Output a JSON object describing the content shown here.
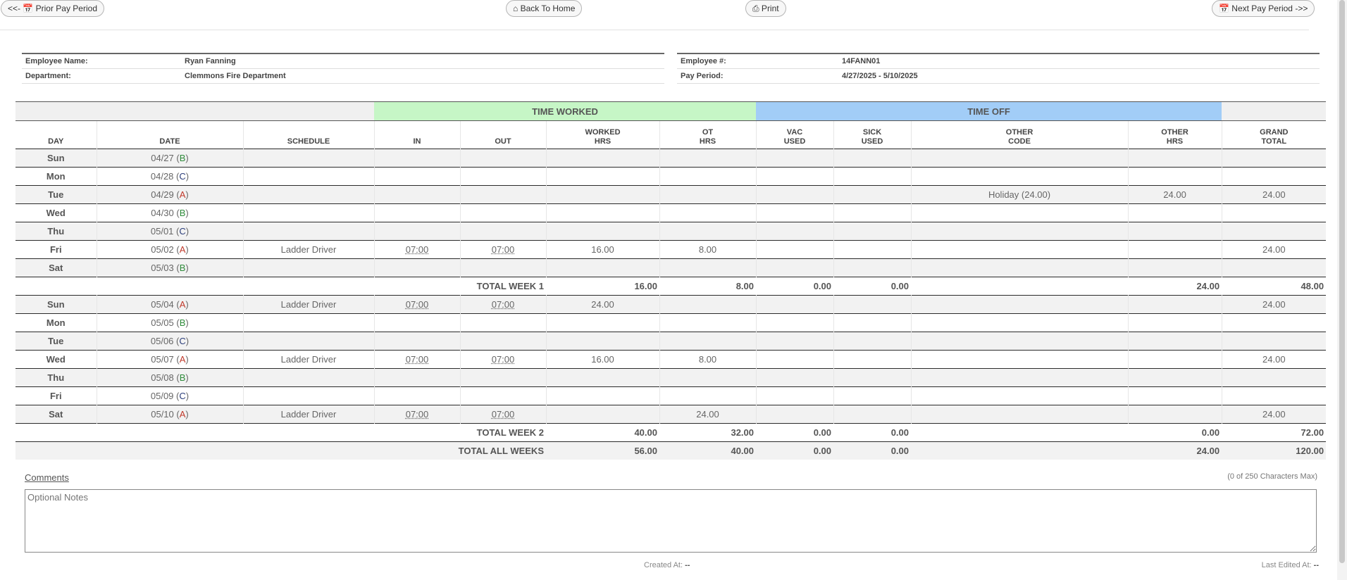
{
  "toolbar": {
    "prior": "<<- 📅 Prior Pay Period",
    "home": "⌂ Back To Home",
    "print": "⎙ Print",
    "next": "📅 Next Pay Period ->>"
  },
  "employee": {
    "name_label": "Employee Name:",
    "name": "Ryan Fanning",
    "dept_label": "Department:",
    "dept": "Clemmons Fire Department",
    "num_label": "Employee #:",
    "num": "14FANN01",
    "period_label": "Pay Period:",
    "period": "4/27/2025 - 5/10/2025"
  },
  "groups": {
    "time_worked": "TIME WORKED",
    "time_off": "TIME OFF"
  },
  "columns": {
    "day": "DAY",
    "date": "DATE",
    "schedule": "SCHEDULE",
    "in": "IN",
    "out": "OUT",
    "worked_1": "WORKED",
    "worked_2": "HRS",
    "ot_1": "OT",
    "ot_2": "HRS",
    "vac_1": "VAC",
    "vac_2": "USED",
    "sick_1": "SICK",
    "sick_2": "USED",
    "oc_1": "OTHER",
    "oc_2": "CODE",
    "oh_1": "OTHER",
    "oh_2": "HRS",
    "gt_1": "GRAND",
    "gt_2": "TOTAL"
  },
  "week1": [
    {
      "day": "Sun",
      "date": "04/27",
      "code": "B",
      "schedule": "",
      "in": "",
      "out": "",
      "worked": "",
      "ot": "",
      "vac": "",
      "sick": "",
      "other_code": "",
      "other_hrs": "",
      "total": ""
    },
    {
      "day": "Mon",
      "date": "04/28",
      "code": "C",
      "schedule": "",
      "in": "",
      "out": "",
      "worked": "",
      "ot": "",
      "vac": "",
      "sick": "",
      "other_code": "",
      "other_hrs": "",
      "total": ""
    },
    {
      "day": "Tue",
      "date": "04/29",
      "code": "A",
      "schedule": "",
      "in": "",
      "out": "",
      "worked": "",
      "ot": "",
      "vac": "",
      "sick": "",
      "other_code": "Holiday (24.00)",
      "other_hrs": "24.00",
      "total": "24.00"
    },
    {
      "day": "Wed",
      "date": "04/30",
      "code": "B",
      "schedule": "",
      "in": "",
      "out": "",
      "worked": "",
      "ot": "",
      "vac": "",
      "sick": "",
      "other_code": "",
      "other_hrs": "",
      "total": ""
    },
    {
      "day": "Thu",
      "date": "05/01",
      "code": "C",
      "schedule": "",
      "in": "",
      "out": "",
      "worked": "",
      "ot": "",
      "vac": "",
      "sick": "",
      "other_code": "",
      "other_hrs": "",
      "total": ""
    },
    {
      "day": "Fri",
      "date": "05/02",
      "code": "A",
      "schedule": "Ladder Driver",
      "in": "07:00",
      "out": "07:00",
      "worked": "16.00",
      "ot": "8.00",
      "vac": "",
      "sick": "",
      "other_code": "",
      "other_hrs": "",
      "total": "24.00"
    },
    {
      "day": "Sat",
      "date": "05/03",
      "code": "B",
      "schedule": "",
      "in": "",
      "out": "",
      "worked": "",
      "ot": "",
      "vac": "",
      "sick": "",
      "other_code": "",
      "other_hrs": "",
      "total": ""
    }
  ],
  "total_week1": {
    "label": "TOTAL WEEK 1",
    "worked": "16.00",
    "ot": "8.00",
    "vac": "0.00",
    "sick": "0.00",
    "other_hrs": "24.00",
    "total": "48.00"
  },
  "week2": [
    {
      "day": "Sun",
      "date": "05/04",
      "code": "A",
      "schedule": "Ladder Driver",
      "in": "07:00",
      "out": "07:00",
      "worked": "24.00",
      "ot": "",
      "vac": "",
      "sick": "",
      "other_code": "",
      "other_hrs": "",
      "total": "24.00"
    },
    {
      "day": "Mon",
      "date": "05/05",
      "code": "B",
      "schedule": "",
      "in": "",
      "out": "",
      "worked": "",
      "ot": "",
      "vac": "",
      "sick": "",
      "other_code": "",
      "other_hrs": "",
      "total": ""
    },
    {
      "day": "Tue",
      "date": "05/06",
      "code": "C",
      "schedule": "",
      "in": "",
      "out": "",
      "worked": "",
      "ot": "",
      "vac": "",
      "sick": "",
      "other_code": "",
      "other_hrs": "",
      "total": ""
    },
    {
      "day": "Wed",
      "date": "05/07",
      "code": "A",
      "schedule": "Ladder Driver",
      "in": "07:00",
      "out": "07:00",
      "worked": "16.00",
      "ot": "8.00",
      "vac": "",
      "sick": "",
      "other_code": "",
      "other_hrs": "",
      "total": "24.00"
    },
    {
      "day": "Thu",
      "date": "05/08",
      "code": "B",
      "schedule": "",
      "in": "",
      "out": "",
      "worked": "",
      "ot": "",
      "vac": "",
      "sick": "",
      "other_code": "",
      "other_hrs": "",
      "total": ""
    },
    {
      "day": "Fri",
      "date": "05/09",
      "code": "C",
      "schedule": "",
      "in": "",
      "out": "",
      "worked": "",
      "ot": "",
      "vac": "",
      "sick": "",
      "other_code": "",
      "other_hrs": "",
      "total": ""
    },
    {
      "day": "Sat",
      "date": "05/10",
      "code": "A",
      "schedule": "Ladder Driver",
      "in": "07:00",
      "out": "07:00",
      "worked": "",
      "ot": "24.00",
      "vac": "",
      "sick": "",
      "other_code": "",
      "other_hrs": "",
      "total": "24.00"
    }
  ],
  "total_week2": {
    "label": "TOTAL WEEK 2",
    "worked": "40.00",
    "ot": "32.00",
    "vac": "0.00",
    "sick": "0.00",
    "other_hrs": "0.00",
    "total": "72.00"
  },
  "total_all": {
    "label": "TOTAL ALL WEEKS",
    "worked": "56.00",
    "ot": "40.00",
    "vac": "0.00",
    "sick": "0.00",
    "other_hrs": "24.00",
    "total": "120.00"
  },
  "comments": {
    "label": "Comments",
    "char_count": "(0 of 250 Characters Max)",
    "placeholder": "Optional Notes",
    "created_label": "Created At:",
    "created_value": "--",
    "edited_label": "Last Edited At:",
    "edited_value": "--"
  }
}
